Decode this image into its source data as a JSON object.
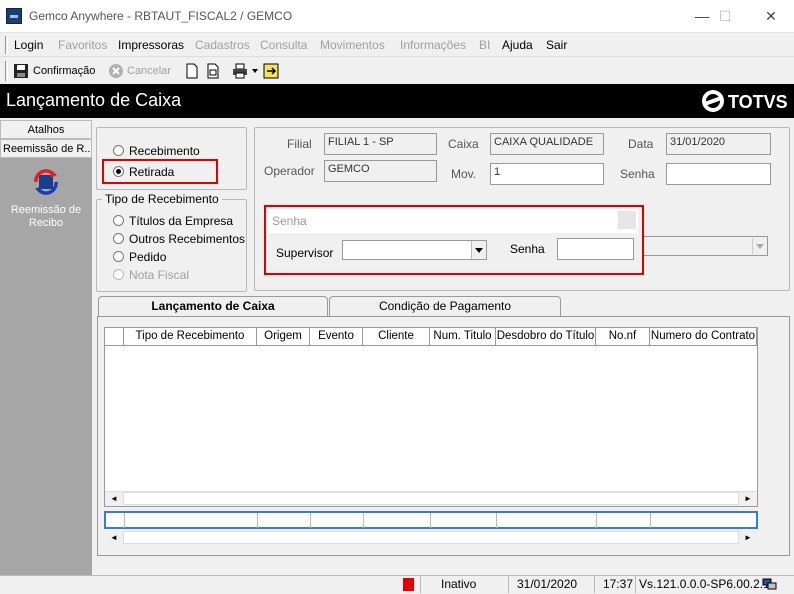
{
  "window": {
    "title": "Gemco Anywhere - RBTAUT_FISCAL2 / GEMCO",
    "minimize": "—",
    "maximize": "☐",
    "close": "✕"
  },
  "menu": {
    "items": [
      {
        "label": "Login",
        "enabled": true
      },
      {
        "label": "Favoritos",
        "enabled": false
      },
      {
        "label": "Impressoras",
        "enabled": true
      },
      {
        "label": "Cadastros",
        "enabled": false
      },
      {
        "label": "Consulta",
        "enabled": false
      },
      {
        "label": "Movimentos",
        "enabled": false
      },
      {
        "label": "Informações",
        "enabled": false
      },
      {
        "label": "BI",
        "enabled": false
      },
      {
        "label": "Ajuda",
        "enabled": true
      },
      {
        "label": "Sair",
        "enabled": true
      }
    ]
  },
  "toolbar": {
    "confirm_label": "Confirmação",
    "cancel_label": "Cancelar"
  },
  "header": {
    "title": "Lançamento de Caixa",
    "logo_text": "TOTVS"
  },
  "sidebar": {
    "tab_atalhos": "Atalhos",
    "tab_reemissao": "Reemissão de R...",
    "shortcut_label": "Reemissão de Recibo"
  },
  "operation": {
    "options": [
      {
        "label": "Recebimento",
        "checked": false
      },
      {
        "label": "Retirada",
        "checked": true
      }
    ]
  },
  "tipo_recebimento": {
    "title": "Tipo de Recebimento",
    "options": [
      {
        "label": "Títulos da Empresa",
        "enabled": true
      },
      {
        "label": "Outros Recebimentos",
        "enabled": true
      },
      {
        "label": "Pedido",
        "enabled": true
      },
      {
        "label": "Nota Fiscal",
        "enabled": false
      }
    ]
  },
  "fields": {
    "filial_label": "Filial",
    "filial_value": "FILIAL 1 - SP",
    "caixa_label": "Caixa",
    "caixa_value": "CAIXA QUALIDADE",
    "data_label": "Data",
    "data_value": "31/01/2020",
    "operador_label": "Operador",
    "operador_value": "GEMCO",
    "mov_label": "Mov.",
    "mov_value": "1",
    "senha_label": "Senha",
    "senha_value": ""
  },
  "senha_dialog": {
    "title": "Senha",
    "supervisor_label": "Supervisor",
    "supervisor_value": "",
    "senha_label": "Senha",
    "senha_value": ""
  },
  "tabs": [
    {
      "label": "Lançamento de Caixa",
      "active": true
    },
    {
      "label": "Condição de Pagamento",
      "active": false
    }
  ],
  "grid": {
    "columns": [
      "Tipo de Recebimento",
      "Origem",
      "Evento",
      "Cliente",
      "Num. Titulo",
      "Desdobro do Título",
      "No.nf",
      "Numero do Contrato"
    ]
  },
  "scroll": {
    "left": "◄",
    "right": "►"
  },
  "statusbar": {
    "status": "Inativo",
    "date": "31/01/2020",
    "time": "17:37",
    "version": "Vs.121.0.0.0-SP6.00.2.1"
  },
  "colors": {
    "header_bg": "#000000",
    "sidebar_bg": "#a6a6a6",
    "highlight": "#e00000",
    "status_indicator": "#e00000"
  }
}
